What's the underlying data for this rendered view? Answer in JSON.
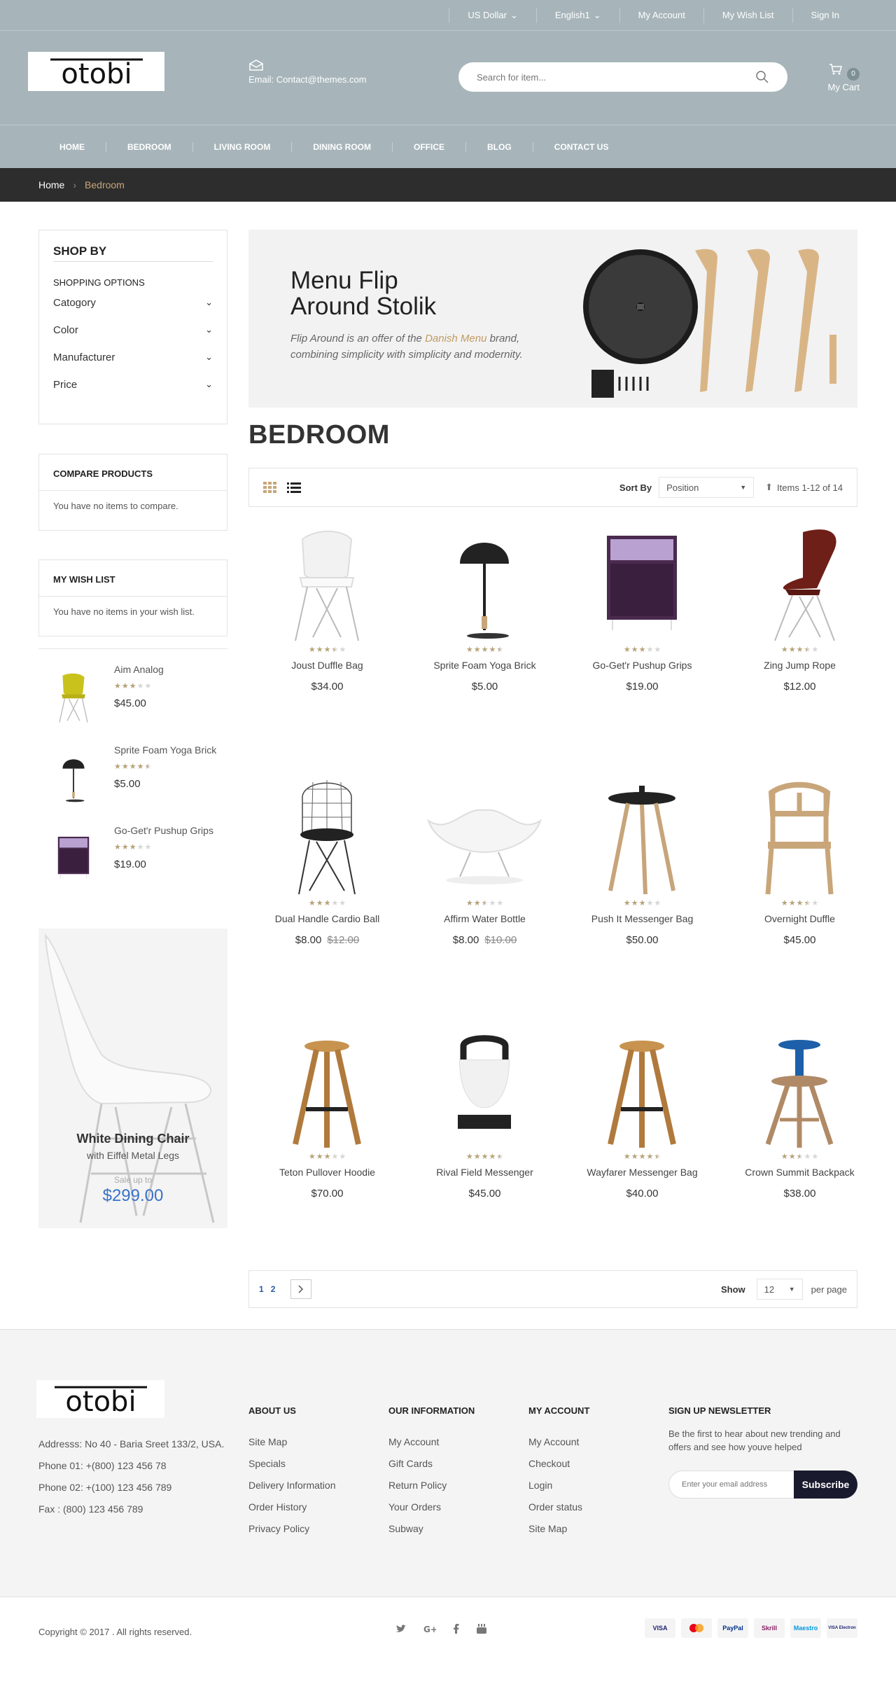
{
  "topbar": {
    "currency": "US Dollar",
    "language": "English1",
    "my_account": "My Account",
    "my_wishlist": "My Wish List",
    "sign_in": "Sign In"
  },
  "header": {
    "logo_text": "otobi",
    "email": "Email: Contact@themes.com",
    "search_placeholder": "Search for item...",
    "cart_count": "0",
    "cart_label": "My Cart"
  },
  "nav": [
    "HOME",
    "BEDROOM",
    "LIVING ROOM",
    "DINING ROOM",
    "OFFICE",
    "BLOG",
    "CONTACT US"
  ],
  "breadcrumb": {
    "home": "Home",
    "sep": "›",
    "current": "Bedroom"
  },
  "sidebar": {
    "shop_by": "SHOP BY",
    "shopping_options": "SHOPPING OPTIONS",
    "filters": [
      "Catogory",
      "Color",
      "Manufacturer",
      "Price"
    ],
    "compare_title": "COMPARE PRODUCTS",
    "compare_text": "You have no items to compare.",
    "wishlist_title": "MY WISH LIST",
    "wishlist_text": "You have no items in your wish list.",
    "mini_products": [
      {
        "name": "Aim Analog",
        "rating": 3,
        "price": "$45.00"
      },
      {
        "name": "Sprite Foam Yoga Brick",
        "rating": 4.5,
        "price": "$5.00"
      },
      {
        "name": "Go-Get'r Pushup Grips",
        "rating": 3,
        "price": "$19.00"
      }
    ],
    "promo": {
      "title": "White Dining Chair",
      "subtitle": "with Eiffel Metal Legs",
      "sale": "Sale up to",
      "price": "$299.00"
    }
  },
  "banner": {
    "title": "Menu Flip Around Stolik",
    "desc_before": "Flip Around is an offer of the ",
    "desc_highlight": "Danish Menu",
    "desc_after": " brand, combining simplicity with simplicity and modernity."
  },
  "page_title": "BEDROOM",
  "toolbar": {
    "sort_by": "Sort By",
    "sort_value": "Position",
    "items": "Items 1-12 of 14"
  },
  "products": [
    {
      "name": "Joust Duffle Bag",
      "rating": 3.5,
      "price": "$34.00",
      "old_price": "",
      "img": "white-chair"
    },
    {
      "name": "Sprite Foam Yoga Brick",
      "rating": 4.5,
      "price": "$5.00",
      "old_price": "",
      "img": "black-lamp"
    },
    {
      "name": "Go-Get'r Pushup Grips",
      "rating": 3,
      "price": "$19.00",
      "old_price": "",
      "img": "purple-nightstand"
    },
    {
      "name": "Zing Jump Rope",
      "rating": 3.5,
      "price": "$12.00",
      "old_price": "",
      "img": "red-chair"
    },
    {
      "name": "Dual Handle Cardio Ball",
      "rating": 3,
      "price": "$8.00",
      "old_price": "$12.00",
      "img": "wire-chair"
    },
    {
      "name": "Affirm Water Bottle",
      "rating": 2.5,
      "price": "$8.00",
      "old_price": "$10.00",
      "img": "lounge-chair"
    },
    {
      "name": "Push It Messenger Bag",
      "rating": 3,
      "price": "$50.00",
      "old_price": "",
      "img": "side-table"
    },
    {
      "name": "Overnight Duffle",
      "rating": 3.5,
      "price": "$45.00",
      "old_price": "",
      "img": "wood-chair"
    },
    {
      "name": "Teton Pullover Hoodie",
      "rating": 3,
      "price": "$70.00",
      "old_price": "",
      "img": "stool"
    },
    {
      "name": "Rival Field Messenger",
      "rating": 4.5,
      "price": "$45.00",
      "old_price": "",
      "img": "lantern"
    },
    {
      "name": "Wayfarer Messenger Bag",
      "rating": 4.5,
      "price": "$40.00",
      "old_price": "",
      "img": "stool"
    },
    {
      "name": "Crown Summit Backpack",
      "rating": 2.5,
      "price": "$38.00",
      "old_price": "",
      "img": "blue-stool"
    }
  ],
  "pager": {
    "pages": [
      "1",
      "2"
    ],
    "show": "Show",
    "limit": "12",
    "per_page": "per page"
  },
  "footer": {
    "address": [
      "Addresss: No 40 - Baria Sreet 133/2, USA.",
      "Phone 01: +(800) 123 456 78",
      "Phone 02: +(100) 123 456 789",
      "Fax : (800) 123 456 789"
    ],
    "about_title": "ABOUT US",
    "about_links": [
      "Site Map",
      "Specials",
      "Delivery Information",
      "Order History",
      "Privacy Policy"
    ],
    "info_title": "OUR INFORMATION",
    "info_links": [
      "My Account",
      "Gift Cards",
      "Return Policy",
      "Your Orders",
      "Subway"
    ],
    "account_title": "MY ACCOUNT",
    "account_links": [
      "My Account",
      "Checkout",
      "Login",
      "Order status",
      "Site Map"
    ],
    "newsletter_title": "SIGN UP NEWSLETTER",
    "newsletter_text": "Be the first to hear about new trending and offers and see how youve helped",
    "newsletter_placeholder": "Enter your email address",
    "subscribe": "Subscribe",
    "copyright": "Copyright © 2017 . All rights reserved.",
    "payments": [
      "VISA",
      "MC",
      "PayPal",
      "Skrill",
      "Maestro",
      "VISA Electron"
    ]
  },
  "colors": {
    "accent": "#c8a67a",
    "header": "#a7b5ba",
    "star": "#b7a278",
    "price_blue": "#3a72c8"
  }
}
